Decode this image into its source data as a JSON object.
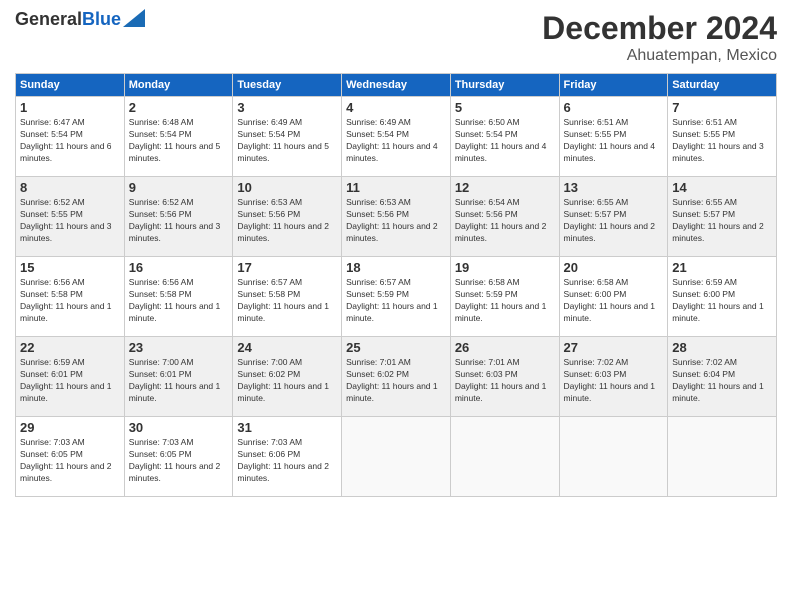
{
  "header": {
    "logo_line1": "General",
    "logo_line2": "Blue",
    "month": "December 2024",
    "location": "Ahuatempan, Mexico"
  },
  "days_of_week": [
    "Sunday",
    "Monday",
    "Tuesday",
    "Wednesday",
    "Thursday",
    "Friday",
    "Saturday"
  ],
  "weeks": [
    [
      {
        "day": "1",
        "sunrise": "6:47 AM",
        "sunset": "5:54 PM",
        "daylight": "11 hours and 6 minutes."
      },
      {
        "day": "2",
        "sunrise": "6:48 AM",
        "sunset": "5:54 PM",
        "daylight": "11 hours and 5 minutes."
      },
      {
        "day": "3",
        "sunrise": "6:49 AM",
        "sunset": "5:54 PM",
        "daylight": "11 hours and 5 minutes."
      },
      {
        "day": "4",
        "sunrise": "6:49 AM",
        "sunset": "5:54 PM",
        "daylight": "11 hours and 4 minutes."
      },
      {
        "day": "5",
        "sunrise": "6:50 AM",
        "sunset": "5:54 PM",
        "daylight": "11 hours and 4 minutes."
      },
      {
        "day": "6",
        "sunrise": "6:51 AM",
        "sunset": "5:55 PM",
        "daylight": "11 hours and 4 minutes."
      },
      {
        "day": "7",
        "sunrise": "6:51 AM",
        "sunset": "5:55 PM",
        "daylight": "11 hours and 3 minutes."
      }
    ],
    [
      {
        "day": "8",
        "sunrise": "6:52 AM",
        "sunset": "5:55 PM",
        "daylight": "11 hours and 3 minutes."
      },
      {
        "day": "9",
        "sunrise": "6:52 AM",
        "sunset": "5:56 PM",
        "daylight": "11 hours and 3 minutes."
      },
      {
        "day": "10",
        "sunrise": "6:53 AM",
        "sunset": "5:56 PM",
        "daylight": "11 hours and 2 minutes."
      },
      {
        "day": "11",
        "sunrise": "6:53 AM",
        "sunset": "5:56 PM",
        "daylight": "11 hours and 2 minutes."
      },
      {
        "day": "12",
        "sunrise": "6:54 AM",
        "sunset": "5:56 PM",
        "daylight": "11 hours and 2 minutes."
      },
      {
        "day": "13",
        "sunrise": "6:55 AM",
        "sunset": "5:57 PM",
        "daylight": "11 hours and 2 minutes."
      },
      {
        "day": "14",
        "sunrise": "6:55 AM",
        "sunset": "5:57 PM",
        "daylight": "11 hours and 2 minutes."
      }
    ],
    [
      {
        "day": "15",
        "sunrise": "6:56 AM",
        "sunset": "5:58 PM",
        "daylight": "11 hours and 1 minute."
      },
      {
        "day": "16",
        "sunrise": "6:56 AM",
        "sunset": "5:58 PM",
        "daylight": "11 hours and 1 minute."
      },
      {
        "day": "17",
        "sunrise": "6:57 AM",
        "sunset": "5:58 PM",
        "daylight": "11 hours and 1 minute."
      },
      {
        "day": "18",
        "sunrise": "6:57 AM",
        "sunset": "5:59 PM",
        "daylight": "11 hours and 1 minute."
      },
      {
        "day": "19",
        "sunrise": "6:58 AM",
        "sunset": "5:59 PM",
        "daylight": "11 hours and 1 minute."
      },
      {
        "day": "20",
        "sunrise": "6:58 AM",
        "sunset": "6:00 PM",
        "daylight": "11 hours and 1 minute."
      },
      {
        "day": "21",
        "sunrise": "6:59 AM",
        "sunset": "6:00 PM",
        "daylight": "11 hours and 1 minute."
      }
    ],
    [
      {
        "day": "22",
        "sunrise": "6:59 AM",
        "sunset": "6:01 PM",
        "daylight": "11 hours and 1 minute."
      },
      {
        "day": "23",
        "sunrise": "7:00 AM",
        "sunset": "6:01 PM",
        "daylight": "11 hours and 1 minute."
      },
      {
        "day": "24",
        "sunrise": "7:00 AM",
        "sunset": "6:02 PM",
        "daylight": "11 hours and 1 minute."
      },
      {
        "day": "25",
        "sunrise": "7:01 AM",
        "sunset": "6:02 PM",
        "daylight": "11 hours and 1 minute."
      },
      {
        "day": "26",
        "sunrise": "7:01 AM",
        "sunset": "6:03 PM",
        "daylight": "11 hours and 1 minute."
      },
      {
        "day": "27",
        "sunrise": "7:02 AM",
        "sunset": "6:03 PM",
        "daylight": "11 hours and 1 minute."
      },
      {
        "day": "28",
        "sunrise": "7:02 AM",
        "sunset": "6:04 PM",
        "daylight": "11 hours and 1 minute."
      }
    ],
    [
      {
        "day": "29",
        "sunrise": "7:03 AM",
        "sunset": "6:05 PM",
        "daylight": "11 hours and 2 minutes."
      },
      {
        "day": "30",
        "sunrise": "7:03 AM",
        "sunset": "6:05 PM",
        "daylight": "11 hours and 2 minutes."
      },
      {
        "day": "31",
        "sunrise": "7:03 AM",
        "sunset": "6:06 PM",
        "daylight": "11 hours and 2 minutes."
      },
      null,
      null,
      null,
      null
    ]
  ]
}
